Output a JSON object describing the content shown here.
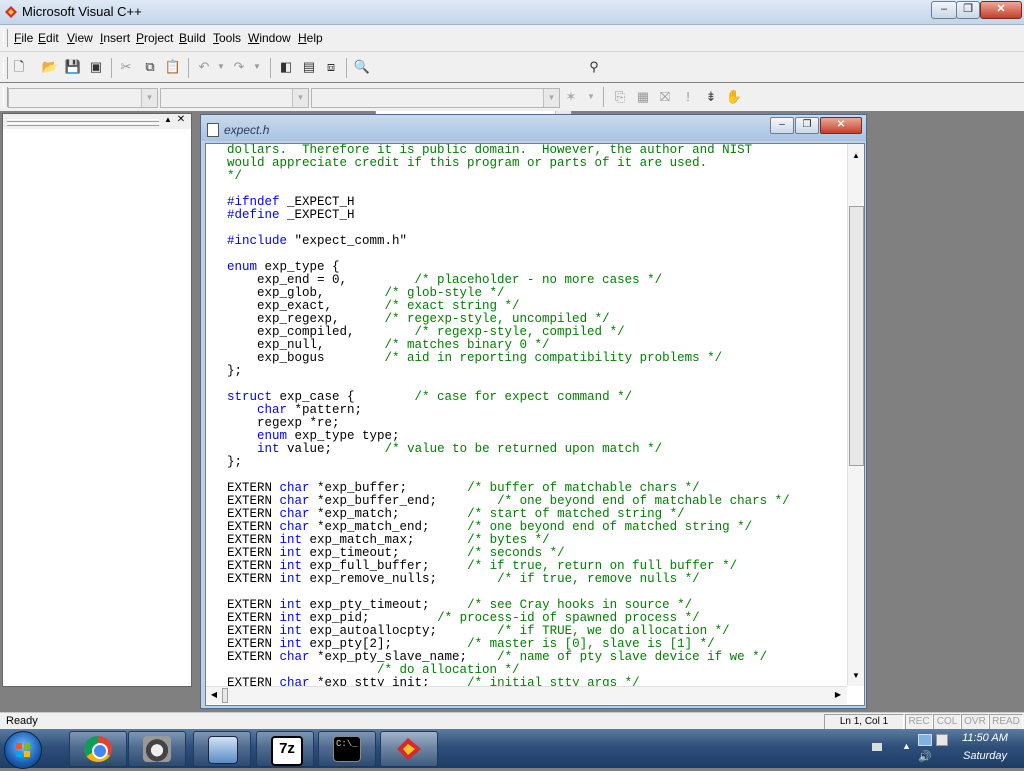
{
  "window": {
    "title": "Microsoft Visual C++",
    "controls": {
      "minimize": "‒",
      "restore": "❐",
      "close": "✕"
    }
  },
  "menu": [
    {
      "label": "File",
      "key": "F"
    },
    {
      "label": "Edit",
      "key": "E"
    },
    {
      "label": "View",
      "key": "V"
    },
    {
      "label": "Insert",
      "key": "I"
    },
    {
      "label": "Project",
      "key": "P"
    },
    {
      "label": "Build",
      "key": "B"
    },
    {
      "label": "Tools",
      "key": "T"
    },
    {
      "label": "Window",
      "key": "W"
    },
    {
      "label": "Help",
      "key": "H"
    }
  ],
  "document": {
    "title": "expect.h",
    "lines": [
      [
        {
          "t": "dollars.  Therefore it is public domain.  However, the author and NIST",
          "c": "cm"
        }
      ],
      [
        {
          "t": "would appreciate credit if this program or parts of it are used.",
          "c": "cm"
        }
      ],
      [
        {
          "t": "*/",
          "c": "cm"
        }
      ],
      [
        {
          "t": ""
        }
      ],
      [
        {
          "t": "#ifndef",
          "c": "kw"
        },
        {
          "t": " _EXPECT_H"
        }
      ],
      [
        {
          "t": "#define",
          "c": "kw"
        },
        {
          "t": " _EXPECT_H"
        }
      ],
      [
        {
          "t": ""
        }
      ],
      [
        {
          "t": "#include",
          "c": "kw"
        },
        {
          "t": " \"expect_comm.h\""
        }
      ],
      [
        {
          "t": ""
        }
      ],
      [
        {
          "t": "enum",
          "c": "kw"
        },
        {
          "t": " exp_type {"
        }
      ],
      [
        {
          "t": "    exp_end = 0,         "
        },
        {
          "t": "/* placeholder - no more cases */",
          "c": "cm"
        }
      ],
      [
        {
          "t": "    exp_glob,        "
        },
        {
          "t": "/* glob-style */",
          "c": "cm"
        }
      ],
      [
        {
          "t": "    exp_exact,       "
        },
        {
          "t": "/* exact string */",
          "c": "cm"
        }
      ],
      [
        {
          "t": "    exp_regexp,      "
        },
        {
          "t": "/* regexp-style, uncompiled */",
          "c": "cm"
        }
      ],
      [
        {
          "t": "    exp_compiled,        "
        },
        {
          "t": "/* regexp-style, compiled */",
          "c": "cm"
        }
      ],
      [
        {
          "t": "    exp_null,        "
        },
        {
          "t": "/* matches binary 0 */",
          "c": "cm"
        }
      ],
      [
        {
          "t": "    exp_bogus        "
        },
        {
          "t": "/* aid in reporting compatibility problems */",
          "c": "cm"
        }
      ],
      [
        {
          "t": "};"
        }
      ],
      [
        {
          "t": ""
        }
      ],
      [
        {
          "t": "struct",
          "c": "kw"
        },
        {
          "t": " exp_case {        "
        },
        {
          "t": "/* case for expect command */",
          "c": "cm"
        }
      ],
      [
        {
          "t": "    "
        },
        {
          "t": "char",
          "c": "kw"
        },
        {
          "t": " *pattern;"
        }
      ],
      [
        {
          "t": "    regexp *re;"
        }
      ],
      [
        {
          "t": "    "
        },
        {
          "t": "enum",
          "c": "kw"
        },
        {
          "t": " exp_type type;"
        }
      ],
      [
        {
          "t": "    "
        },
        {
          "t": "int",
          "c": "kw"
        },
        {
          "t": " value;       "
        },
        {
          "t": "/* value to be returned upon match */",
          "c": "cm"
        }
      ],
      [
        {
          "t": "};"
        }
      ],
      [
        {
          "t": ""
        }
      ],
      [
        {
          "t": "EXTERN "
        },
        {
          "t": "char",
          "c": "kw"
        },
        {
          "t": " *exp_buffer;        "
        },
        {
          "t": "/* buffer of matchable chars */",
          "c": "cm"
        }
      ],
      [
        {
          "t": "EXTERN "
        },
        {
          "t": "char",
          "c": "kw"
        },
        {
          "t": " *exp_buffer_end;        "
        },
        {
          "t": "/* one beyond end of matchable chars */",
          "c": "cm"
        }
      ],
      [
        {
          "t": "EXTERN "
        },
        {
          "t": "char",
          "c": "kw"
        },
        {
          "t": " *exp_match;         "
        },
        {
          "t": "/* start of matched string */",
          "c": "cm"
        }
      ],
      [
        {
          "t": "EXTERN "
        },
        {
          "t": "char",
          "c": "kw"
        },
        {
          "t": " *exp_match_end;     "
        },
        {
          "t": "/* one beyond end of matched string */",
          "c": "cm"
        }
      ],
      [
        {
          "t": "EXTERN "
        },
        {
          "t": "int",
          "c": "kw"
        },
        {
          "t": " exp_match_max;       "
        },
        {
          "t": "/* bytes */",
          "c": "cm"
        }
      ],
      [
        {
          "t": "EXTERN "
        },
        {
          "t": "int",
          "c": "kw"
        },
        {
          "t": " exp_timeout;         "
        },
        {
          "t": "/* seconds */",
          "c": "cm"
        }
      ],
      [
        {
          "t": "EXTERN "
        },
        {
          "t": "int",
          "c": "kw"
        },
        {
          "t": " exp_full_buffer;     "
        },
        {
          "t": "/* if true, return on full buffer */",
          "c": "cm"
        }
      ],
      [
        {
          "t": "EXTERN "
        },
        {
          "t": "int",
          "c": "kw"
        },
        {
          "t": " exp_remove_nulls;        "
        },
        {
          "t": "/* if true, remove nulls */",
          "c": "cm"
        }
      ],
      [
        {
          "t": ""
        }
      ],
      [
        {
          "t": "EXTERN "
        },
        {
          "t": "int",
          "c": "kw"
        },
        {
          "t": " exp_pty_timeout;     "
        },
        {
          "t": "/* see Cray hooks in source */",
          "c": "cm"
        }
      ],
      [
        {
          "t": "EXTERN "
        },
        {
          "t": "int",
          "c": "kw"
        },
        {
          "t": " exp_pid;         "
        },
        {
          "t": "/* process-id of spawned process */",
          "c": "cm"
        }
      ],
      [
        {
          "t": "EXTERN "
        },
        {
          "t": "int",
          "c": "kw"
        },
        {
          "t": " exp_autoallocpty;        "
        },
        {
          "t": "/* if TRUE, we do allocation */",
          "c": "cm"
        }
      ],
      [
        {
          "t": "EXTERN "
        },
        {
          "t": "int",
          "c": "kw"
        },
        {
          "t": " exp_pty[2];          "
        },
        {
          "t": "/* master is [0], slave is [1] */",
          "c": "cm"
        }
      ],
      [
        {
          "t": "EXTERN "
        },
        {
          "t": "char",
          "c": "kw"
        },
        {
          "t": " *exp_pty_slave_name;    "
        },
        {
          "t": "/* name of pty slave device if we */",
          "c": "cm"
        }
      ],
      [
        {
          "t": "                    "
        },
        {
          "t": "/* do allocation */",
          "c": "cm"
        }
      ],
      [
        {
          "t": "EXTERN "
        },
        {
          "t": "char",
          "c": "kw"
        },
        {
          "t": " *exp_stty_init;     "
        },
        {
          "t": "/* initial stty args */",
          "c": "cm"
        }
      ]
    ]
  },
  "status": {
    "text": "Ready",
    "position": "Ln 1, Col 1",
    "indicators": [
      "REC",
      "COL",
      "OVR",
      "READ"
    ]
  },
  "taskbar": {
    "time": "11:50 AM",
    "day": "Saturday",
    "apps": [
      "chrome-icon",
      "raccoon-app-icon",
      "computer-icon",
      "7zip-icon",
      "cmd-icon",
      "visual-cpp-icon"
    ]
  }
}
